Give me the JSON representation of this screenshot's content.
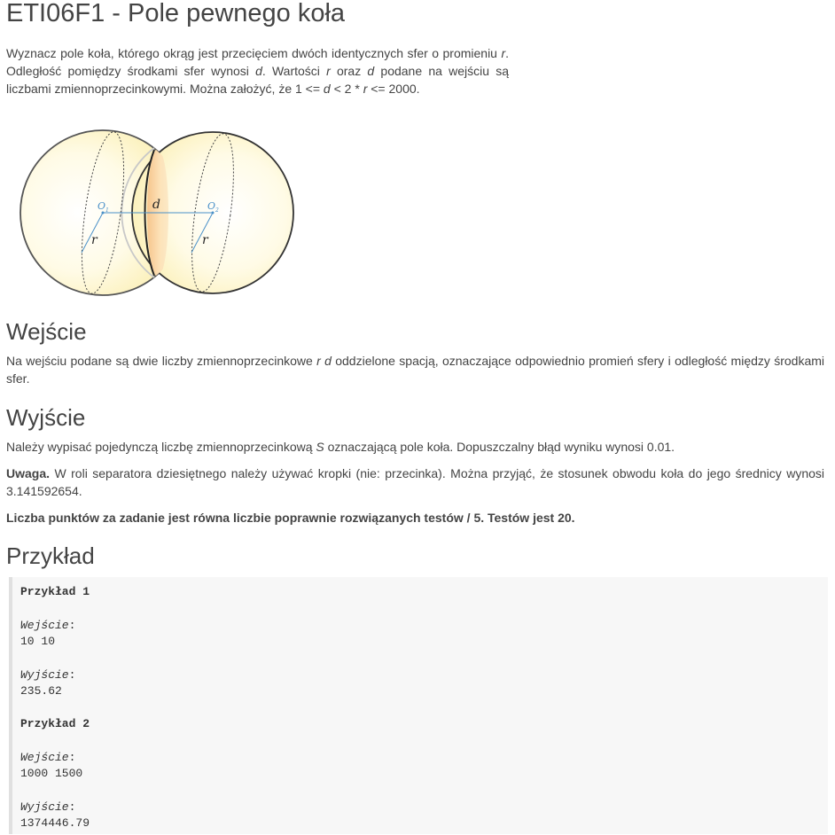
{
  "title": "ETI06F1 - Pole pewnego koła",
  "intro": {
    "t1": "Wyznacz pole koła, którego okrąg jest przecięciem dwóch identycznych sfer o promieniu ",
    "r1": "r",
    "t2": ". Odległość pomiędzy środkami sfer wynosi ",
    "d1": "d",
    "t3": ". Wartości ",
    "r2": "r",
    "t4": " oraz ",
    "d2": "d",
    "t5": " podane na wejściu są liczbami zmiennoprzecinkowymi. Można założyć, że 1 <= ",
    "d3": "d",
    "t6": " < 2 * ",
    "r3": "r",
    "t7": " <= 2000."
  },
  "figure": {
    "label_o1": "O",
    "label_o1_sub": "1",
    "label_o2": "O",
    "label_o2_sub": "2",
    "label_d": "d",
    "label_r": "r"
  },
  "input_section": {
    "heading": "Wejście",
    "t1": "Na wejściu podane są dwie liczby zmiennoprzecinkowe ",
    "vars": "r d",
    "t2": " oddzielone spacją, oznaczające odpowiednio promień sfery i odległość między środkami sfer."
  },
  "output_section": {
    "heading": "Wyjście",
    "t1": "Należy wypisać pojedynczą liczbę zmiennoprzecinkową ",
    "var": "S",
    "t2": " oznaczającą pole koła. Dopuszczalny błąd wyniku wynosi 0.01.",
    "note_label": "Uwaga.",
    "note_text": " W roli separatora dziesiętnego należy używać kropki (nie: przecinka). Można przyjąć, że stosunek obwodu koła do jego średnicy wynosi 3.141592654.",
    "points": "Liczba punktów za zadanie jest równa liczbie poprawnie rozwiązanych testów / 5. Testów jest 20."
  },
  "example_section": {
    "heading": "Przykład",
    "examples": [
      {
        "title": "Przykład 1",
        "input_label": "Wejście",
        "input": "10 10",
        "output_label": "Wyjście",
        "output": "235.62"
      },
      {
        "title": "Przykład 2",
        "input_label": "Wejście",
        "input": "1000 1500",
        "output_label": "Wyjście",
        "output": "1374446.79"
      }
    ]
  }
}
